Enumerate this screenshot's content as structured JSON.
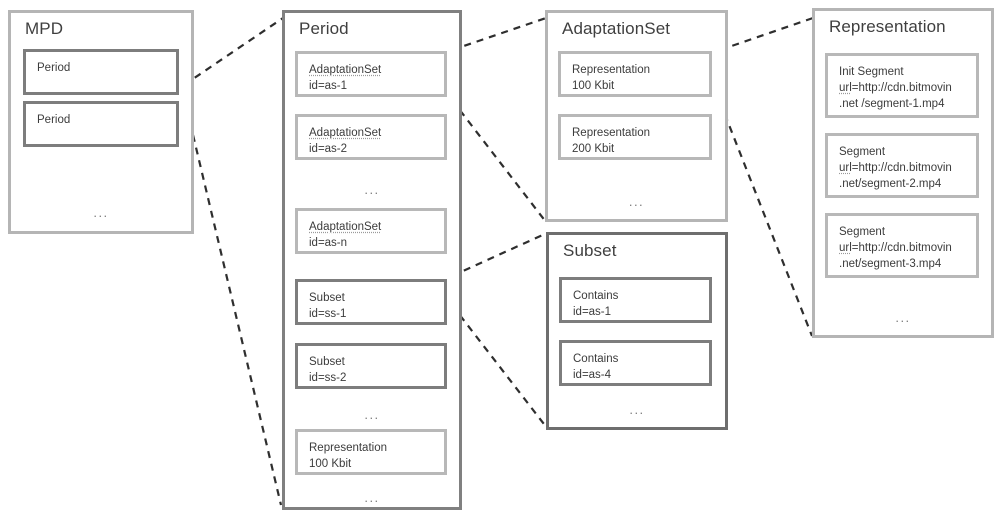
{
  "diagram": {
    "title": "MPEG-DASH MPD structure",
    "accent_border_light": "#b8b8b8",
    "accent_border_dark": "#7d7d7d",
    "connector_color": "#2e2e2e",
    "ellipsis": "•••"
  },
  "columns": [
    {
      "id": "mpd",
      "title": "MPD",
      "items": [
        {
          "lines": [
            "Period"
          ]
        },
        {
          "lines": [
            "Period"
          ]
        }
      ],
      "ellipsis": "..."
    },
    {
      "id": "period",
      "title": "Period",
      "items": [
        {
          "lines": [
            "AdaptationSet",
            "id=as-1"
          ]
        },
        {
          "lines": [
            "AdaptationSet",
            "id=as-2"
          ]
        },
        {
          "lines": [
            "AdaptationSet",
            "id=as-n"
          ]
        },
        {
          "lines": [
            "Subset",
            "id=ss-1"
          ]
        },
        {
          "lines": [
            "Subset",
            "id=ss-2"
          ]
        },
        {
          "lines": [
            "Representation",
            "100 Kbit"
          ]
        }
      ],
      "ellipsis": "..."
    },
    {
      "id": "adaptationset",
      "title": "AdaptationSet",
      "items": [
        {
          "lines": [
            "Representation",
            "100 Kbit"
          ]
        },
        {
          "lines": [
            "Representation",
            "200 Kbit"
          ]
        }
      ],
      "ellipsis": "..."
    },
    {
      "id": "subset",
      "title": "Subset",
      "items": [
        {
          "lines": [
            "Contains",
            "id=as-1"
          ]
        },
        {
          "lines": [
            "Contains",
            "id=as-4"
          ]
        }
      ],
      "ellipsis": "..."
    },
    {
      "id": "representation",
      "title": "Representation",
      "items": [
        {
          "lines": [
            "Init Segment",
            "url=http://cdn.bitmovin",
            ".net /segment-1.mp4"
          ]
        },
        {
          "lines": [
            "Segment",
            "url=http://cdn.bitmovin",
            ".net/segment-2.mp4"
          ]
        },
        {
          "lines": [
            "Segment",
            "url=http://cdn.bitmovin",
            ".net/segment-3.mp4"
          ]
        }
      ],
      "ellipsis": "..."
    }
  ],
  "labels": {
    "mpd_title": "MPD",
    "mpd_period_1": "Period",
    "mpd_period_2": "Period",
    "mpd_ellipsis": "...",
    "period_title": "Period",
    "period_as1_name": "AdaptationSet",
    "period_as1_id": "id=as-1",
    "period_as2_name": "AdaptationSet",
    "period_as2_id": "id=as-2",
    "period_ellipsis_1": "...",
    "period_asn_name": "AdaptationSet",
    "period_asn_id": "id=as-n",
    "period_ss1_name": "Subset",
    "period_ss1_id": "id=ss-1",
    "period_ss2_name": "Subset",
    "period_ss2_id": "id=ss-2",
    "period_ellipsis_2": "...",
    "period_rep_name": "Representation",
    "period_rep_rate": "100 Kbit",
    "period_ellipsis_3": "...",
    "as_title": "AdaptationSet",
    "as_rep1_name": "Representation",
    "as_rep1_rate": "100 Kbit",
    "as_rep2_name": "Representation",
    "as_rep2_rate": "200 Kbit",
    "as_ellipsis": "...",
    "subset_title": "Subset",
    "subset_c1_name": "Contains",
    "subset_c1_id": "id=as-1",
    "subset_c2_name": "Contains",
    "subset_c2_id": "id=as-4",
    "subset_ellipsis": "...",
    "rep_title": "Representation",
    "rep_seg1_name": "Init Segment",
    "rep_seg1_url_a": "url",
    "rep_seg1_url_b": "=http://cdn.bitmovin",
    "rep_seg1_url_c": ".net /segment-1.mp4",
    "rep_seg2_name": "Segment",
    "rep_seg2_url_a": "url",
    "rep_seg2_url_b": "=http://cdn.bitmovin",
    "rep_seg2_url_c": ".net/segment-2.mp4",
    "rep_seg3_name": "Segment",
    "rep_seg3_url_a": "url",
    "rep_seg3_url_b": "=http://cdn.bitmovin",
    "rep_seg3_url_c": ".net/segment-3.mp4",
    "rep_ellipsis": "..."
  }
}
